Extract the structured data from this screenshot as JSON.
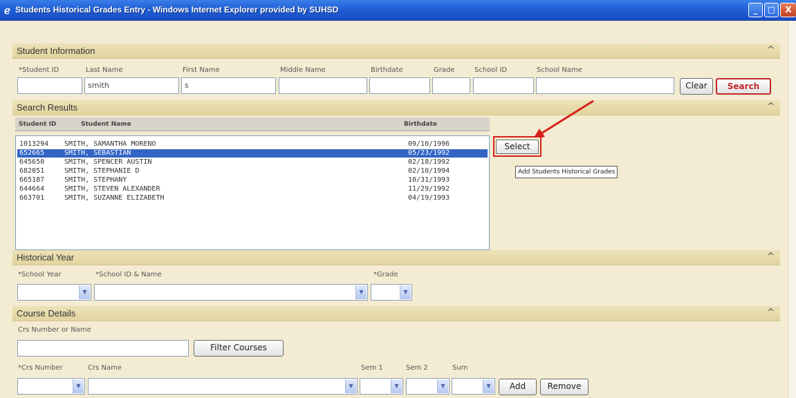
{
  "window": {
    "title": "Students Historical Grades Entry - Windows Internet Explorer provided by SUHSD",
    "minimize": "_",
    "maximize": "□",
    "close": "X"
  },
  "student_info": {
    "header": "Student Information",
    "collapse": "^",
    "labels": {
      "student_id": "*Student ID",
      "last_name": "Last Name",
      "first_name": "First Name",
      "middle_name": "Middle Name",
      "birthdate": "Birthdate",
      "grade": "Grade",
      "school_id": "School ID",
      "school_name": "School Name"
    },
    "values": {
      "student_id": "",
      "last_name": "smith",
      "first_name": "s",
      "middle_name": "",
      "birthdate": "",
      "grade": "",
      "school_id": "",
      "school_name": ""
    },
    "clear_label": "Clear",
    "search_label": "Search"
  },
  "search_results": {
    "header": "Search Results",
    "collapse": "^",
    "columns": {
      "id": "Student ID",
      "name": "Student Name",
      "birthdate": "Birthdate"
    },
    "rows": [
      {
        "id": "1013294",
        "name": "SMITH, SAMANTHA MORENO",
        "birthdate": "09/10/1996",
        "selected": false
      },
      {
        "id": "652665",
        "name": "SMITH, SEBASTIAN",
        "birthdate": "05/23/1992",
        "selected": true
      },
      {
        "id": "645650",
        "name": "SMITH, SPENCER AUSTIN",
        "birthdate": "02/18/1992",
        "selected": false
      },
      {
        "id": "682051",
        "name": "SMITH, STEPHANIE D",
        "birthdate": "02/10/1994",
        "selected": false
      },
      {
        "id": "665187",
        "name": "SMITH, STEPHANY",
        "birthdate": "10/31/1993",
        "selected": false
      },
      {
        "id": "644664",
        "name": "SMITH, STEVEN ALEXANDER",
        "birthdate": "11/29/1992",
        "selected": false
      },
      {
        "id": "663701",
        "name": "SMITH, SUZANNE ELIZABETH",
        "birthdate": "04/19/1993",
        "selected": false
      }
    ],
    "select_label": "Select",
    "tooltip": "Add Students Historical Grades",
    "annotation_color": "#d8201a"
  },
  "historical_year": {
    "header": "Historical Year",
    "collapse": "^",
    "labels": {
      "school_year": "*School Year",
      "school": "*School ID & Name",
      "grade": "*Grade"
    }
  },
  "course_details": {
    "header": "Course Details",
    "collapse": "^",
    "crs_search_label": "Crs Number or Name",
    "filter_label": "Filter Courses",
    "labels": {
      "crs_number": "*Crs Number",
      "crs_name": "Crs Name",
      "sem1": "Sem 1",
      "sem2": "Sem 2",
      "sum": "Sum"
    },
    "add_label": "Add",
    "remove_label": "Remove"
  }
}
